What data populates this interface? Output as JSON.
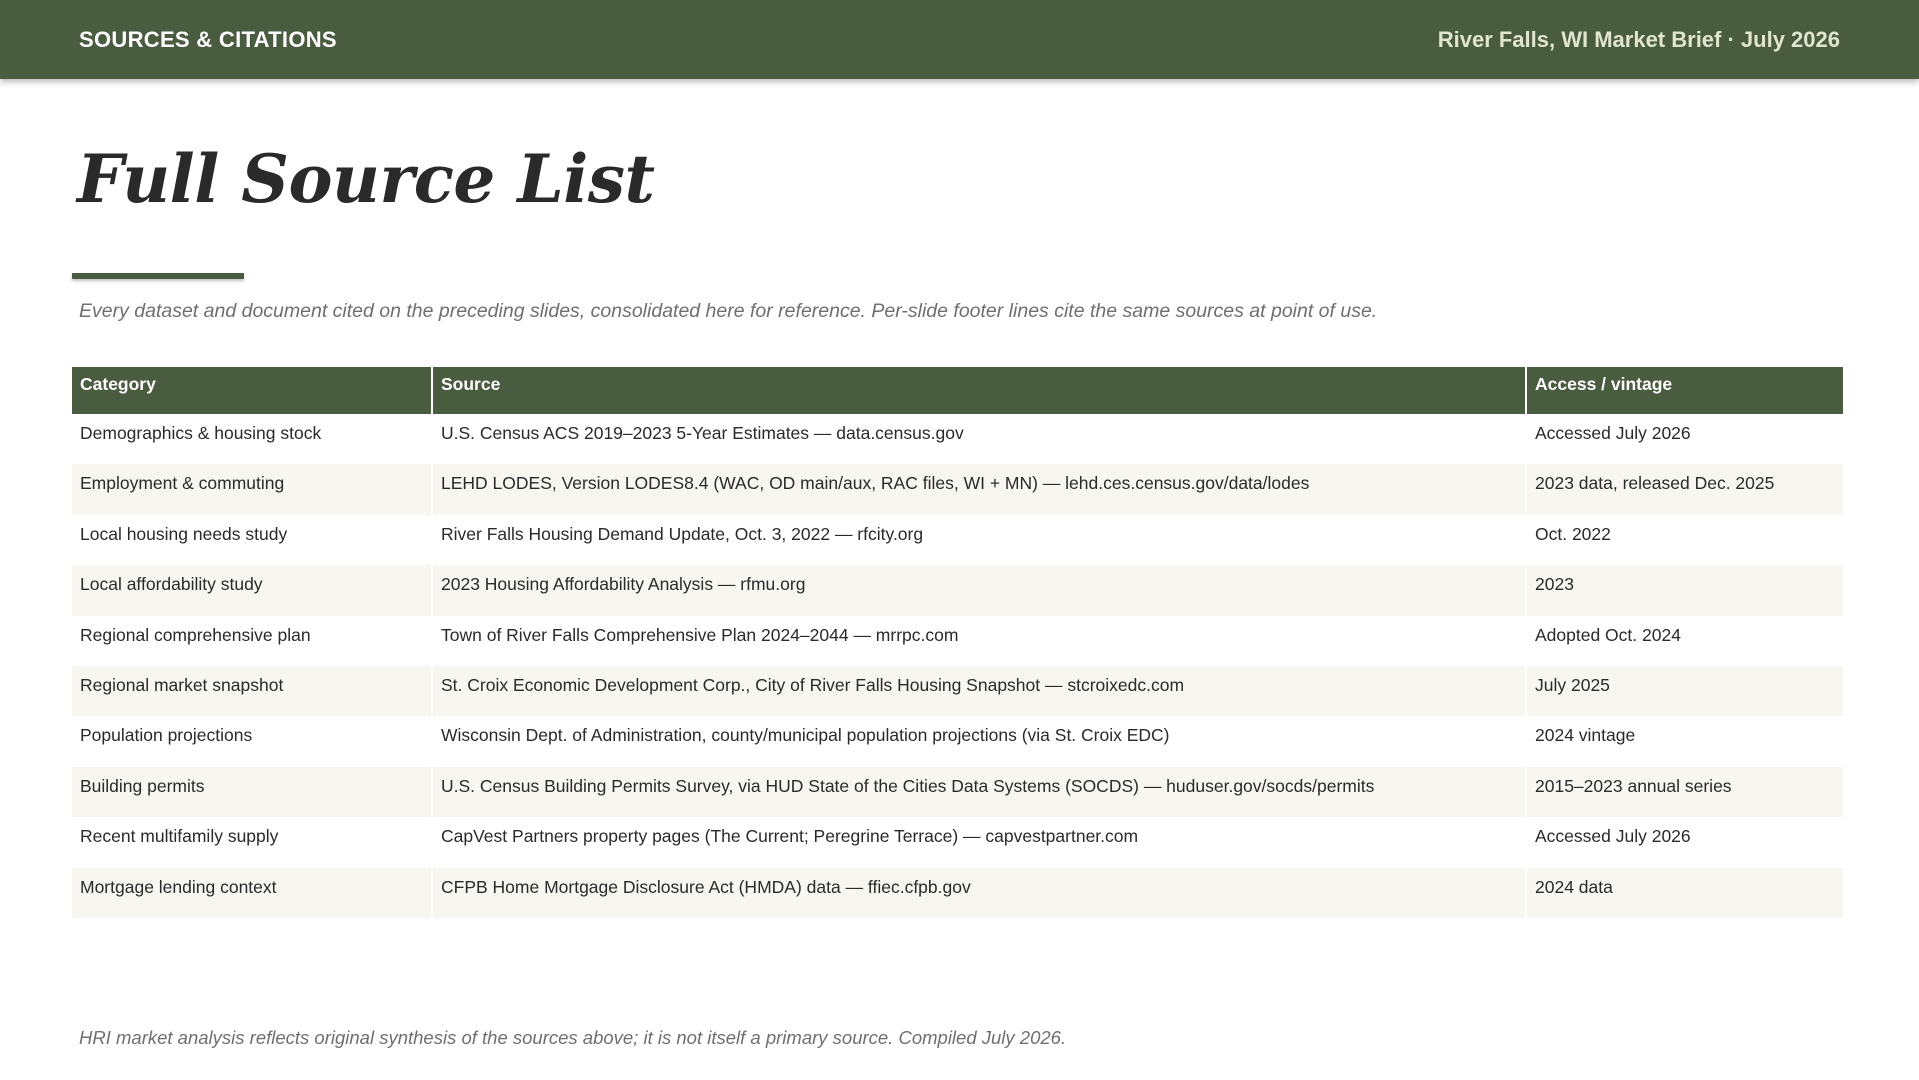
{
  "header": {
    "section_label": "SOURCES & CITATIONS",
    "brief_label": "River Falls, WI Market Brief · July 2026"
  },
  "title": "Full Source List",
  "subtitle": "Every dataset and document cited on the preceding slides, consolidated here for reference. Per-slide footer lines cite the same sources at point of use.",
  "table": {
    "headers": [
      "Category",
      "Source",
      "Access / vintage"
    ],
    "rows": [
      [
        "Demographics & housing stock",
        "U.S. Census ACS 2019–2023 5-Year Estimates — data.census.gov",
        "Accessed July 2026"
      ],
      [
        "Employment & commuting",
        "LEHD LODES, Version LODES8.4 (WAC, OD main/aux, RAC files, WI + MN) — lehd.ces.census.gov/data/lodes",
        "2023 data, released Dec. 2025"
      ],
      [
        "Local housing needs study",
        "River Falls Housing Demand Update, Oct. 3, 2022 — rfcity.org",
        "Oct. 2022"
      ],
      [
        "Local affordability study",
        "2023 Housing Affordability Analysis — rfmu.org",
        "2023"
      ],
      [
        "Regional comprehensive plan",
        "Town of River Falls Comprehensive Plan 2024–2044 — mrrpc.com",
        "Adopted Oct. 2024"
      ],
      [
        "Regional market snapshot",
        "St. Croix Economic Development Corp., City of River Falls Housing Snapshot — stcroixedc.com",
        "July 2025"
      ],
      [
        "Population projections",
        "Wisconsin Dept. of Administration, county/municipal population projections (via St. Croix EDC)",
        "2024 vintage"
      ],
      [
        "Building permits",
        "U.S. Census Building Permits Survey, via HUD State of the Cities Data Systems (SOCDS) — huduser.gov/socds/permits",
        "2015–2023 annual series"
      ],
      [
        "Recent multifamily supply",
        "CapVest Partners property pages (The Current; Peregrine Terrace) — capvestpartner.com",
        "Accessed July 2026"
      ],
      [
        "Mortgage lending context",
        "CFPB Home Mortgage Disclosure Act (HMDA) data — ffiec.cfpb.gov",
        "2024 data"
      ]
    ]
  },
  "footer": "HRI market analysis reflects original synthesis of the sources above; it is not itself a primary source. Compiled July 2026.",
  "colors": {
    "brand_green": "#4a5c40",
    "header_text_light": "#dfe5cf",
    "row_stripe": "#f7f6f1"
  }
}
